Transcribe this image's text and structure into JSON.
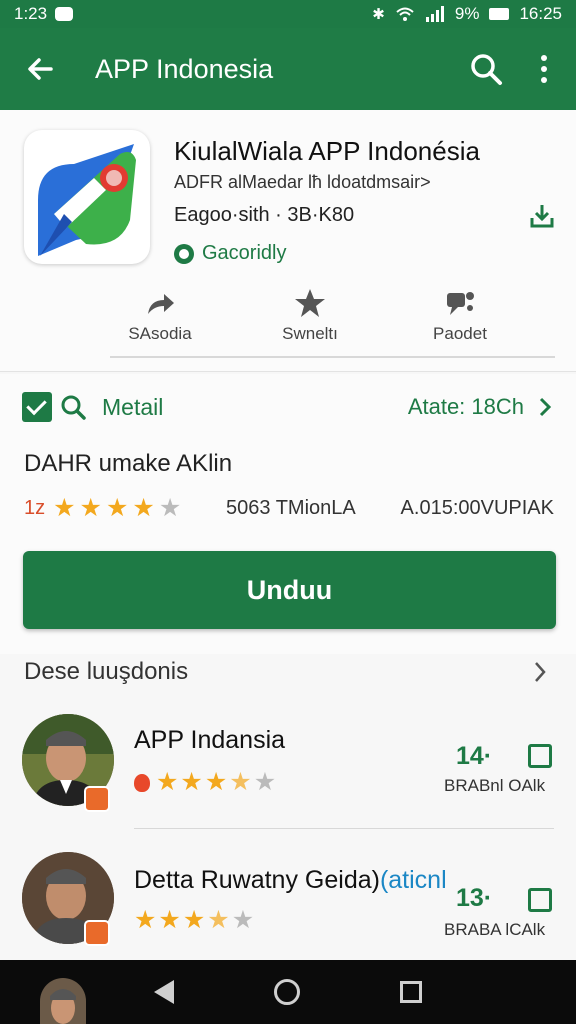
{
  "status_bar": {
    "time_left": "1:23",
    "battery": "9%",
    "time_right": "16:25"
  },
  "app_bar": {
    "title": "APP Indonesia"
  },
  "app": {
    "name": "KiulalWiala APP Indonésia",
    "developer": "ADFR alMaedar lħ ldoatdmsair>",
    "size": "Eagoo·sith · 3B·K80",
    "verified_label": "Gacoridly",
    "actions": [
      {
        "label": "SAsodia",
        "icon": "share-icon"
      },
      {
        "label": "Swneltı",
        "icon": "star-icon"
      },
      {
        "label": "Paodet",
        "icon": "feedback-icon"
      }
    ]
  },
  "detail": {
    "label": "Metail",
    "update_text": "Atate: 18Ch",
    "title": "DAHR umake AKlin",
    "rating_num": "1z",
    "rating_value": 4.5,
    "downloads": "5063 TMionLA",
    "price": "A.015:00VUPIAK",
    "install_label": "Unduu"
  },
  "related": {
    "title": "Dese luuşdonis",
    "items": [
      {
        "name": "APP Indansia",
        "name_accent": "",
        "rating_value": 3.5,
        "count": "14·",
        "sub": "BRABnl OAlk",
        "fire": true
      },
      {
        "name": "Detta Ruwatny Geida)",
        "name_accent": "(aticnl",
        "rating_value": 3.5,
        "count": "13·",
        "sub": "BRABA lCAlk",
        "fire": false
      }
    ]
  },
  "colors": {
    "brand_green": "#1e7a45",
    "star_yellow": "#f3a81e",
    "accent_blue": "#1b87c5"
  }
}
